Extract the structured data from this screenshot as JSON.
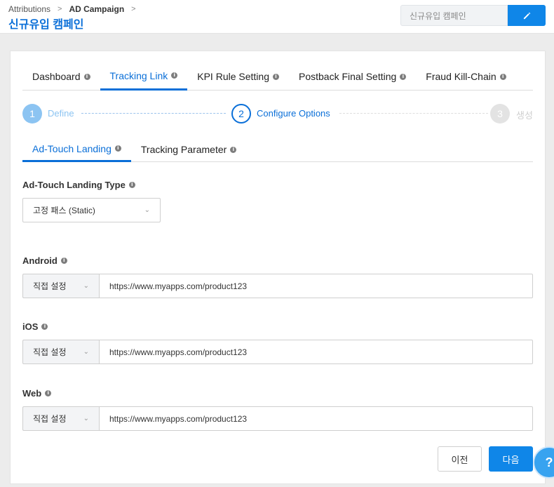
{
  "breadcrumb": {
    "items": [
      "Attributions",
      "AD Campaign"
    ]
  },
  "page_title": "신규유입 캠페인",
  "title_field": {
    "value": "신규유입 캠페인"
  },
  "edit_icon": "pencil-icon",
  "tabs": [
    {
      "label": "Dashboard"
    },
    {
      "label": "Tracking Link",
      "active": true
    },
    {
      "label": "KPI Rule Setting"
    },
    {
      "label": "Postback Final Setting"
    },
    {
      "label": "Fraud Kill-Chain"
    }
  ],
  "steps": [
    {
      "number": "1",
      "label": "Define",
      "state": "done"
    },
    {
      "number": "2",
      "label": "Configure Options",
      "state": "current"
    },
    {
      "number": "3",
      "label": "생성",
      "state": "pending"
    }
  ],
  "subtabs": [
    {
      "label": "Ad-Touch Landing",
      "active": true
    },
    {
      "label": "Tracking Parameter"
    }
  ],
  "landing_type": {
    "label": "Ad-Touch Landing Type",
    "selected": "고정 패스 (Static)"
  },
  "platforms": [
    {
      "label": "Android",
      "mode": "직접 설정",
      "url": "https://www.myapps.com/product123"
    },
    {
      "label": "iOS",
      "mode": "직접 설정",
      "url": "https://www.myapps.com/product123"
    },
    {
      "label": "Web",
      "mode": "직접 설정",
      "url": "https://www.myapps.com/product123"
    }
  ],
  "buttons": {
    "prev": "이전",
    "next": "다음"
  },
  "colors": {
    "accent": "#0a6fd8",
    "primary_button": "#0f86e8",
    "step_done": "#8cc4f2",
    "step_pending": "#e3e3e3"
  }
}
